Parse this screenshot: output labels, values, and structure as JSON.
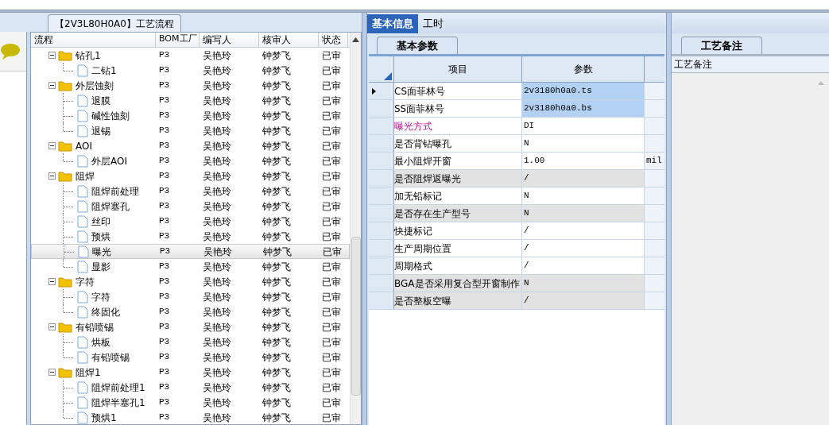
{
  "left_panel": {
    "title": "【2V3L80H0A0】工艺流程"
  },
  "tree": {
    "columns": [
      "流程",
      "BOM工厂",
      "编写人",
      "核审人",
      "状态"
    ],
    "rows": [
      {
        "name": "钻孔1",
        "factory": "P3",
        "author": "吴艳玲",
        "reviewer": "钟梦飞",
        "status": "已审",
        "expanded": true,
        "selected": false,
        "children": [
          {
            "name": "二钻1",
            "factory": "P3",
            "author": "吴艳玲",
            "reviewer": "钟梦飞",
            "status": "已审",
            "selected": false
          }
        ]
      },
      {
        "name": "外层蚀刻",
        "factory": "P3",
        "author": "吴艳玲",
        "reviewer": "钟梦飞",
        "status": "已审",
        "expanded": true,
        "selected": false,
        "children": [
          {
            "name": "退膜",
            "factory": "P3",
            "author": "吴艳玲",
            "reviewer": "钟梦飞",
            "status": "已审",
            "selected": false
          },
          {
            "name": "碱性蚀刻",
            "factory": "P3",
            "author": "吴艳玲",
            "reviewer": "钟梦飞",
            "status": "已审",
            "selected": false
          },
          {
            "name": "退锡",
            "factory": "P3",
            "author": "吴艳玲",
            "reviewer": "钟梦飞",
            "status": "已审",
            "selected": false
          }
        ]
      },
      {
        "name": "AOI",
        "factory": "P3",
        "author": "吴艳玲",
        "reviewer": "钟梦飞",
        "status": "已审",
        "expanded": true,
        "selected": false,
        "children": [
          {
            "name": "外层AOI",
            "factory": "P3",
            "author": "吴艳玲",
            "reviewer": "钟梦飞",
            "status": "已审",
            "selected": false
          }
        ]
      },
      {
        "name": "阻焊",
        "factory": "P3",
        "author": "吴艳玲",
        "reviewer": "钟梦飞",
        "status": "已审",
        "expanded": true,
        "selected": false,
        "children": [
          {
            "name": "阻焊前处理",
            "factory": "P3",
            "author": "吴艳玲",
            "reviewer": "钟梦飞",
            "status": "已审",
            "selected": false
          },
          {
            "name": "阻焊塞孔",
            "factory": "P3",
            "author": "吴艳玲",
            "reviewer": "钟梦飞",
            "status": "已审",
            "selected": false
          },
          {
            "name": "丝印",
            "factory": "P3",
            "author": "吴艳玲",
            "reviewer": "钟梦飞",
            "status": "已审",
            "selected": false
          },
          {
            "name": "预烘",
            "factory": "P3",
            "author": "吴艳玲",
            "reviewer": "钟梦飞",
            "status": "已审",
            "selected": false
          },
          {
            "name": "曝光",
            "factory": "P3",
            "author": "吴艳玲",
            "reviewer": "钟梦飞",
            "status": "已审",
            "selected": true
          },
          {
            "name": "显影",
            "factory": "P3",
            "author": "吴艳玲",
            "reviewer": "钟梦飞",
            "status": "已审",
            "selected": false
          }
        ]
      },
      {
        "name": "字符",
        "factory": "P3",
        "author": "吴艳玲",
        "reviewer": "钟梦飞",
        "status": "已审",
        "expanded": true,
        "selected": false,
        "children": [
          {
            "name": "字符",
            "factory": "P3",
            "author": "吴艳玲",
            "reviewer": "钟梦飞",
            "status": "已审",
            "selected": false
          },
          {
            "name": "终固化",
            "factory": "P3",
            "author": "吴艳玲",
            "reviewer": "钟梦飞",
            "status": "已审",
            "selected": false
          }
        ]
      },
      {
        "name": "有铅喷锡",
        "factory": "P3",
        "author": "吴艳玲",
        "reviewer": "钟梦飞",
        "status": "已审",
        "expanded": true,
        "selected": false,
        "children": [
          {
            "name": "烘板",
            "factory": "P3",
            "author": "吴艳玲",
            "reviewer": "钟梦飞",
            "status": "已审",
            "selected": false
          },
          {
            "name": "有铅喷锡",
            "factory": "P3",
            "author": "吴艳玲",
            "reviewer": "钟梦飞",
            "status": "已审",
            "selected": false
          }
        ]
      },
      {
        "name": "阻焊1",
        "factory": "P3",
        "author": "吴艳玲",
        "reviewer": "钟梦飞",
        "status": "已审",
        "expanded": true,
        "selected": false,
        "children": [
          {
            "name": "阻焊前处理1",
            "factory": "P3",
            "author": "吴艳玲",
            "reviewer": "钟梦飞",
            "status": "已审",
            "selected": false
          },
          {
            "name": "阻焊半塞孔1",
            "factory": "P3",
            "author": "吴艳玲",
            "reviewer": "钟梦飞",
            "status": "已审",
            "selected": false
          },
          {
            "name": "预烘1",
            "factory": "P3",
            "author": "吴艳玲",
            "reviewer": "钟梦飞",
            "status": "已审",
            "selected": false
          }
        ]
      }
    ]
  },
  "tabs": [
    {
      "label": "基本信息",
      "selected": true
    },
    {
      "label": "工时",
      "selected": false
    }
  ],
  "sub_tab": {
    "label": "基本参数"
  },
  "params": {
    "columns": [
      "项目",
      "参数"
    ],
    "rows": [
      {
        "item": "CS面菲林号",
        "value": "2v3180h0a0.ts",
        "selected": true,
        "current": true,
        "highlight": false
      },
      {
        "item": "SS面菲林号",
        "value": "2v3180h0a0.bs",
        "selected": true,
        "current": false,
        "highlight": false
      },
      {
        "item": "曝光方式",
        "value": "DI",
        "selected": false,
        "current": false,
        "highlight": true,
        "editable": true
      },
      {
        "item": "是否背钻曝孔",
        "value": "N",
        "selected": false,
        "current": false,
        "highlight": false,
        "editable": true
      },
      {
        "item": "最小阻焊开窗",
        "value": "1.00",
        "unit": "mil",
        "selected": false,
        "current": false,
        "highlight": false,
        "editable": true
      },
      {
        "item": "是否阻焊返曝光",
        "value": "/",
        "selected": false,
        "current": false,
        "highlight": false,
        "editable": false
      },
      {
        "item": "加无铅标记",
        "value": "N",
        "selected": false,
        "current": false,
        "highlight": false,
        "editable": true
      },
      {
        "item": "是否存在生产型号",
        "value": "N",
        "selected": false,
        "current": false,
        "highlight": false,
        "editable": false
      },
      {
        "item": "快捷标记",
        "value": "/",
        "selected": false,
        "current": false,
        "highlight": false,
        "editable": true
      },
      {
        "item": "生产周期位置",
        "value": "/",
        "selected": false,
        "current": false,
        "highlight": false,
        "editable": true
      },
      {
        "item": "周期格式",
        "value": "/",
        "selected": false,
        "current": false,
        "highlight": false,
        "editable": true
      },
      {
        "item": "BGA是否采用复合型开窗制作",
        "value": "N",
        "selected": false,
        "current": false,
        "highlight": false,
        "editable": false
      },
      {
        "item": "是否整板空曝",
        "value": "/",
        "selected": false,
        "current": false,
        "highlight": false,
        "editable": false
      }
    ]
  },
  "notes_panel": {
    "tab": "工艺备注",
    "label": "工艺备注"
  }
}
